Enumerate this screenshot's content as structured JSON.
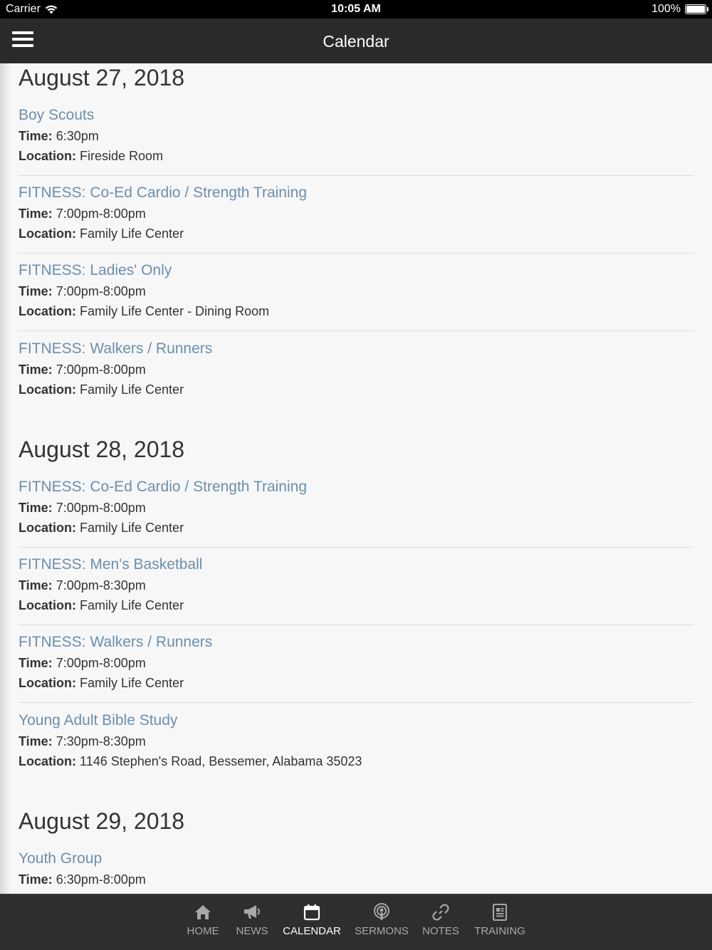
{
  "status_bar": {
    "carrier": "Carrier",
    "time": "10:05 AM",
    "battery": "100%"
  },
  "nav": {
    "title": "Calendar"
  },
  "labels": {
    "time": "Time:",
    "location": "Location:"
  },
  "days": [
    {
      "date": "August 27, 2018",
      "events": [
        {
          "title": "Boy Scouts",
          "time": "6:30pm",
          "location": "Fireside Room"
        },
        {
          "title": "FITNESS: Co-Ed Cardio / Strength Training",
          "time": "7:00pm-8:00pm",
          "location": "Family Life Center"
        },
        {
          "title": "FITNESS: Ladies' Only",
          "time": "7:00pm-8:00pm",
          "location": "Family Life Center - Dining Room"
        },
        {
          "title": "FITNESS: Walkers / Runners",
          "time": "7:00pm-8:00pm",
          "location": "Family Life Center"
        }
      ]
    },
    {
      "date": "August 28, 2018",
      "events": [
        {
          "title": "FITNESS: Co-Ed Cardio / Strength Training",
          "time": "7:00pm-8:00pm",
          "location": "Family Life Center"
        },
        {
          "title": "FITNESS: Men's Basketball",
          "time": "7:00pm-8:30pm",
          "location": "Family Life Center"
        },
        {
          "title": "FITNESS: Walkers / Runners",
          "time": "7:00pm-8:00pm",
          "location": "Family Life Center"
        },
        {
          "title": "Young Adult Bible Study",
          "time": "7:30pm-8:30pm",
          "location": "1146 Stephen's Road, Bessemer, Alabama 35023"
        }
      ]
    },
    {
      "date": "August 29, 2018",
      "events": [
        {
          "title": "Youth Group",
          "time": "6:30pm-8:00pm"
        }
      ]
    }
  ],
  "tabs": [
    {
      "label": "HOME",
      "icon": "home-icon",
      "active": false
    },
    {
      "label": "NEWS",
      "icon": "megaphone-icon",
      "active": false
    },
    {
      "label": "CALENDAR",
      "icon": "calendar-icon",
      "active": true
    },
    {
      "label": "SERMONS",
      "icon": "podcast-icon",
      "active": false
    },
    {
      "label": "NOTES",
      "icon": "link-icon",
      "active": false
    },
    {
      "label": "TRAINING",
      "icon": "document-icon",
      "active": false
    }
  ]
}
